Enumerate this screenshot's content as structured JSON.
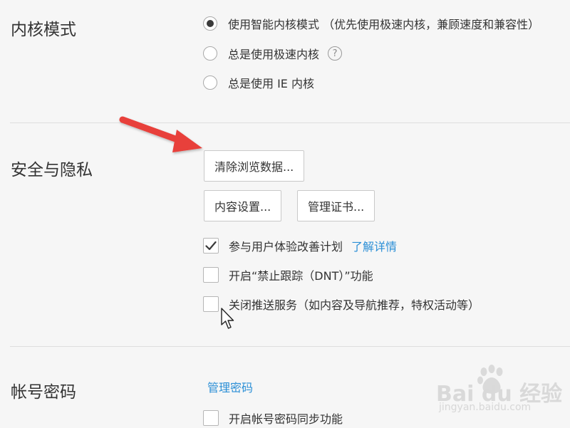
{
  "sections": {
    "kernel": {
      "title": "内核模式",
      "options": [
        {
          "label": "使用智能内核模式 （优先使用极速内核，兼顾速度和兼容性）",
          "checked": true
        },
        {
          "label": "总是使用极速内核",
          "checked": false
        },
        {
          "label": "总是使用 IE 内核",
          "checked": false
        }
      ],
      "help_symbol": "?"
    },
    "privacy": {
      "title": "安全与隐私",
      "buttons": {
        "clear_data": "清除浏览数据...",
        "content_settings": "内容设置...",
        "manage_certs": "管理证书..."
      },
      "checkboxes": [
        {
          "label": "参与用户体验改善计划",
          "checked": true,
          "link": "了解详情"
        },
        {
          "label": "开启“禁止跟踪（DNT）”功能",
          "checked": false
        },
        {
          "label": "关闭推送服务（如内容及导航推荐，特权活动等）",
          "checked": false
        }
      ]
    },
    "account": {
      "title": "帐号密码",
      "manage_link": "管理密码",
      "checkboxes": [
        {
          "label": "开启帐号密码同步功能",
          "checked": false
        }
      ]
    }
  },
  "watermark": {
    "logo": "Bai du 经验",
    "sub": "jingyan.baidu.com"
  },
  "colors": {
    "background": "#f6f6f6",
    "link": "#2b8fd6",
    "arrow": "#e8403a",
    "text": "#333333"
  }
}
